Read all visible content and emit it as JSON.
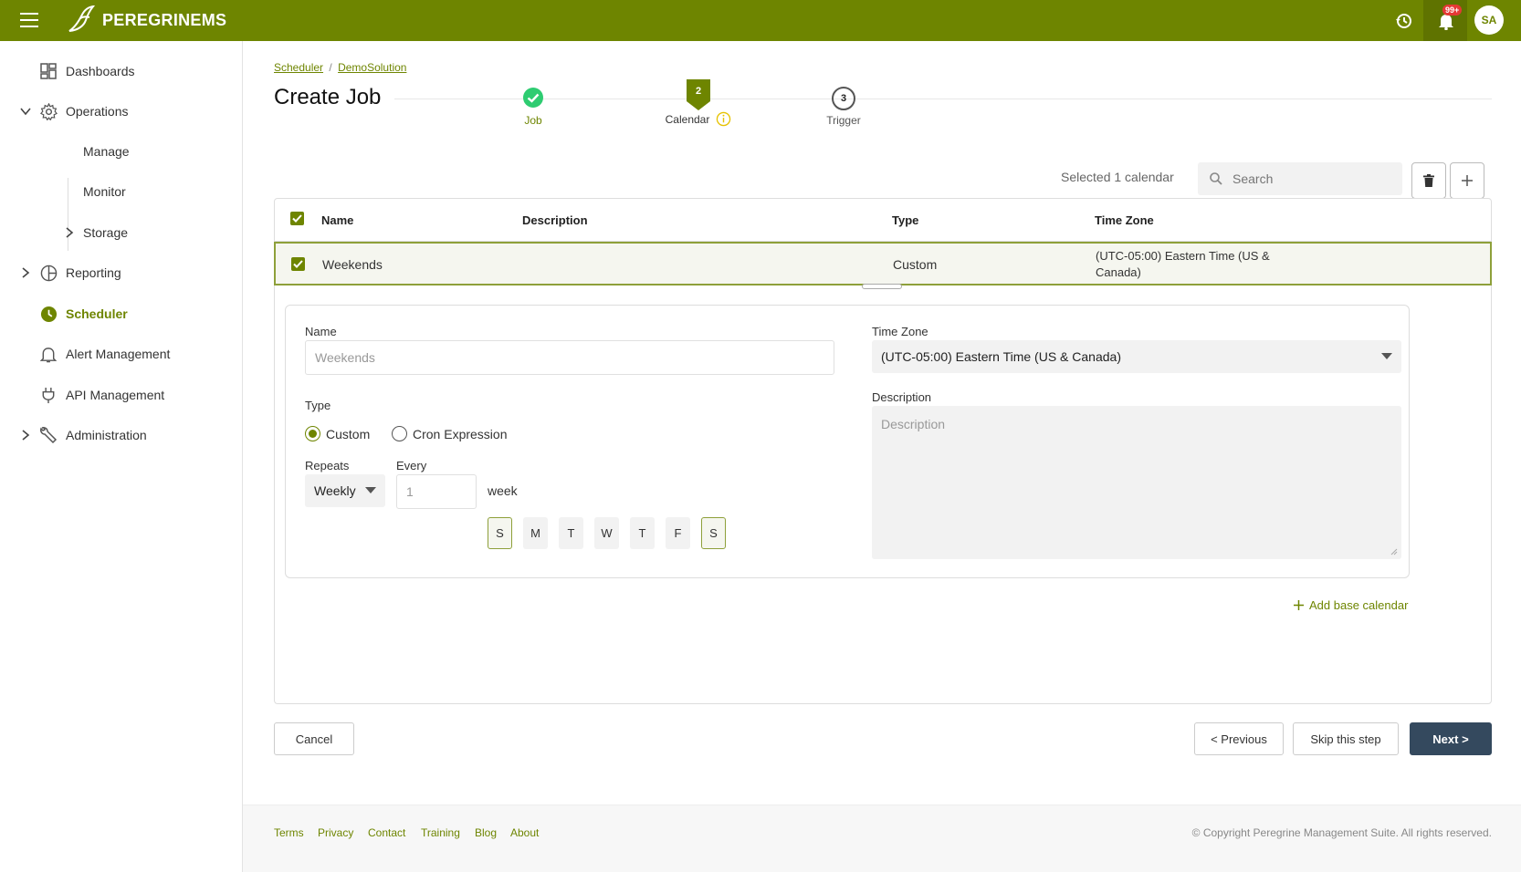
{
  "brand": {
    "name": "PEREGRINEMS",
    "accent": "#6e8500"
  },
  "topbar": {
    "notifications_badge": "99+",
    "avatar_initials": "SA"
  },
  "sidebar": {
    "items": [
      {
        "label": "Dashboards",
        "icon": "dashboard-icon"
      },
      {
        "label": "Operations",
        "icon": "gear-icon"
      },
      {
        "label": "Manage"
      },
      {
        "label": "Monitor"
      },
      {
        "label": "Storage"
      },
      {
        "label": "Reporting",
        "icon": "pie-chart-icon"
      },
      {
        "label": "Scheduler",
        "icon": "clock-icon"
      },
      {
        "label": "Alert Management",
        "icon": "bell-icon"
      },
      {
        "label": "API Management",
        "icon": "plug-icon"
      },
      {
        "label": "Administration",
        "icon": "wrench-icon"
      }
    ]
  },
  "breadcrumb": {
    "parent": "Scheduler",
    "separator": "/",
    "current": "DemoSolution"
  },
  "page": {
    "title": "Create Job"
  },
  "stepper": {
    "steps": [
      {
        "label": "Job",
        "state": "done"
      },
      {
        "label": "Calendar",
        "number": "2",
        "state": "active"
      },
      {
        "label": "Trigger",
        "number": "3",
        "state": "pending"
      }
    ]
  },
  "toolbar": {
    "selected_text": "Selected 1 calendar",
    "search_placeholder": "Search"
  },
  "table": {
    "columns": [
      "Name",
      "Description",
      "Type",
      "Time Zone"
    ],
    "rows": [
      {
        "name": "Weekends",
        "description": "",
        "type": "Custom",
        "timezone_line1": "(UTC-05:00) Eastern Time (US &",
        "timezone_line2": "Canada)"
      }
    ]
  },
  "form": {
    "name_label": "Name",
    "name_value": "Weekends",
    "timezone_label": "Time Zone",
    "timezone_value": "(UTC-05:00) Eastern Time (US & Canada)",
    "type_label": "Type",
    "type_options": [
      "Custom",
      "Cron Expression"
    ],
    "type_selected": "Custom",
    "description_label": "Description",
    "description_placeholder": "Description",
    "repeats_label": "Repeats",
    "repeats_value": "Weekly",
    "every_label": "Every",
    "every_placeholder": "1",
    "every_unit": "week",
    "days": [
      {
        "label": "S",
        "selected": true
      },
      {
        "label": "M",
        "selected": false
      },
      {
        "label": "T",
        "selected": false
      },
      {
        "label": "W",
        "selected": false
      },
      {
        "label": "T",
        "selected": false
      },
      {
        "label": "F",
        "selected": false
      },
      {
        "label": "S",
        "selected": true
      }
    ],
    "add_base_calendar": "Add base calendar"
  },
  "actions": {
    "cancel": "Cancel",
    "previous": "< Previous",
    "skip": "Skip this step",
    "next": "Next >"
  },
  "footer": {
    "links": [
      "Terms",
      "Privacy",
      "Contact",
      "Training",
      "Blog",
      "About"
    ],
    "copyright": "© Copyright Peregrine Management Suite. All rights reserved."
  }
}
